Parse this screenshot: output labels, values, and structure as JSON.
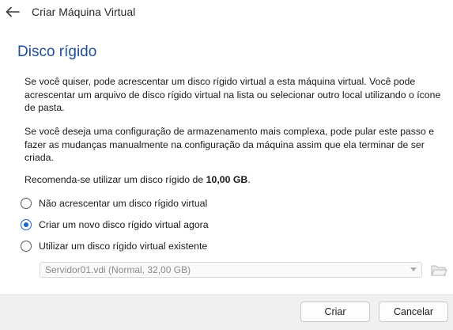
{
  "window": {
    "title": "Criar Máquina Virtual",
    "back_icon": "arrow-left-icon"
  },
  "page": {
    "title": "Disco rígido",
    "paragraph1": "Se você quiser, pode acrescentar um disco rígido virtual a esta máquina virtual. Você pode acrescentar um arquivo de disco rígido virtual na lista ou selecionar outro local utilizando o ícone de pasta.",
    "paragraph2": "Se você deseja uma configuração de armazenamento mais complexa, pode pular este passo e fazer as mudanças manualmente na configuração da máquina assim que ela terminar de ser criada.",
    "recommend_prefix": "Recomenda-se utilizar um disco rígido de ",
    "recommend_size": "10,00 GB",
    "recommend_suffix": "."
  },
  "options": [
    {
      "label": "Não acrescentar um disco rígido virtual",
      "checked": false
    },
    {
      "label": "Criar um novo disco rígido virtual agora",
      "checked": true
    },
    {
      "label": "Utilizar um disco rígido virtual existente",
      "checked": false
    }
  ],
  "existing_disk": {
    "selected": "Servidor01.vdi (Normal, 32,00 GB)",
    "enabled": false,
    "folder_icon": "folder-open-icon"
  },
  "buttons": {
    "create": "Criar",
    "cancel": "Cancelar"
  },
  "colors": {
    "title_blue": "#1f4e99",
    "radio_accent": "#1b64c8",
    "footer_bg": "#f0f0f0"
  }
}
